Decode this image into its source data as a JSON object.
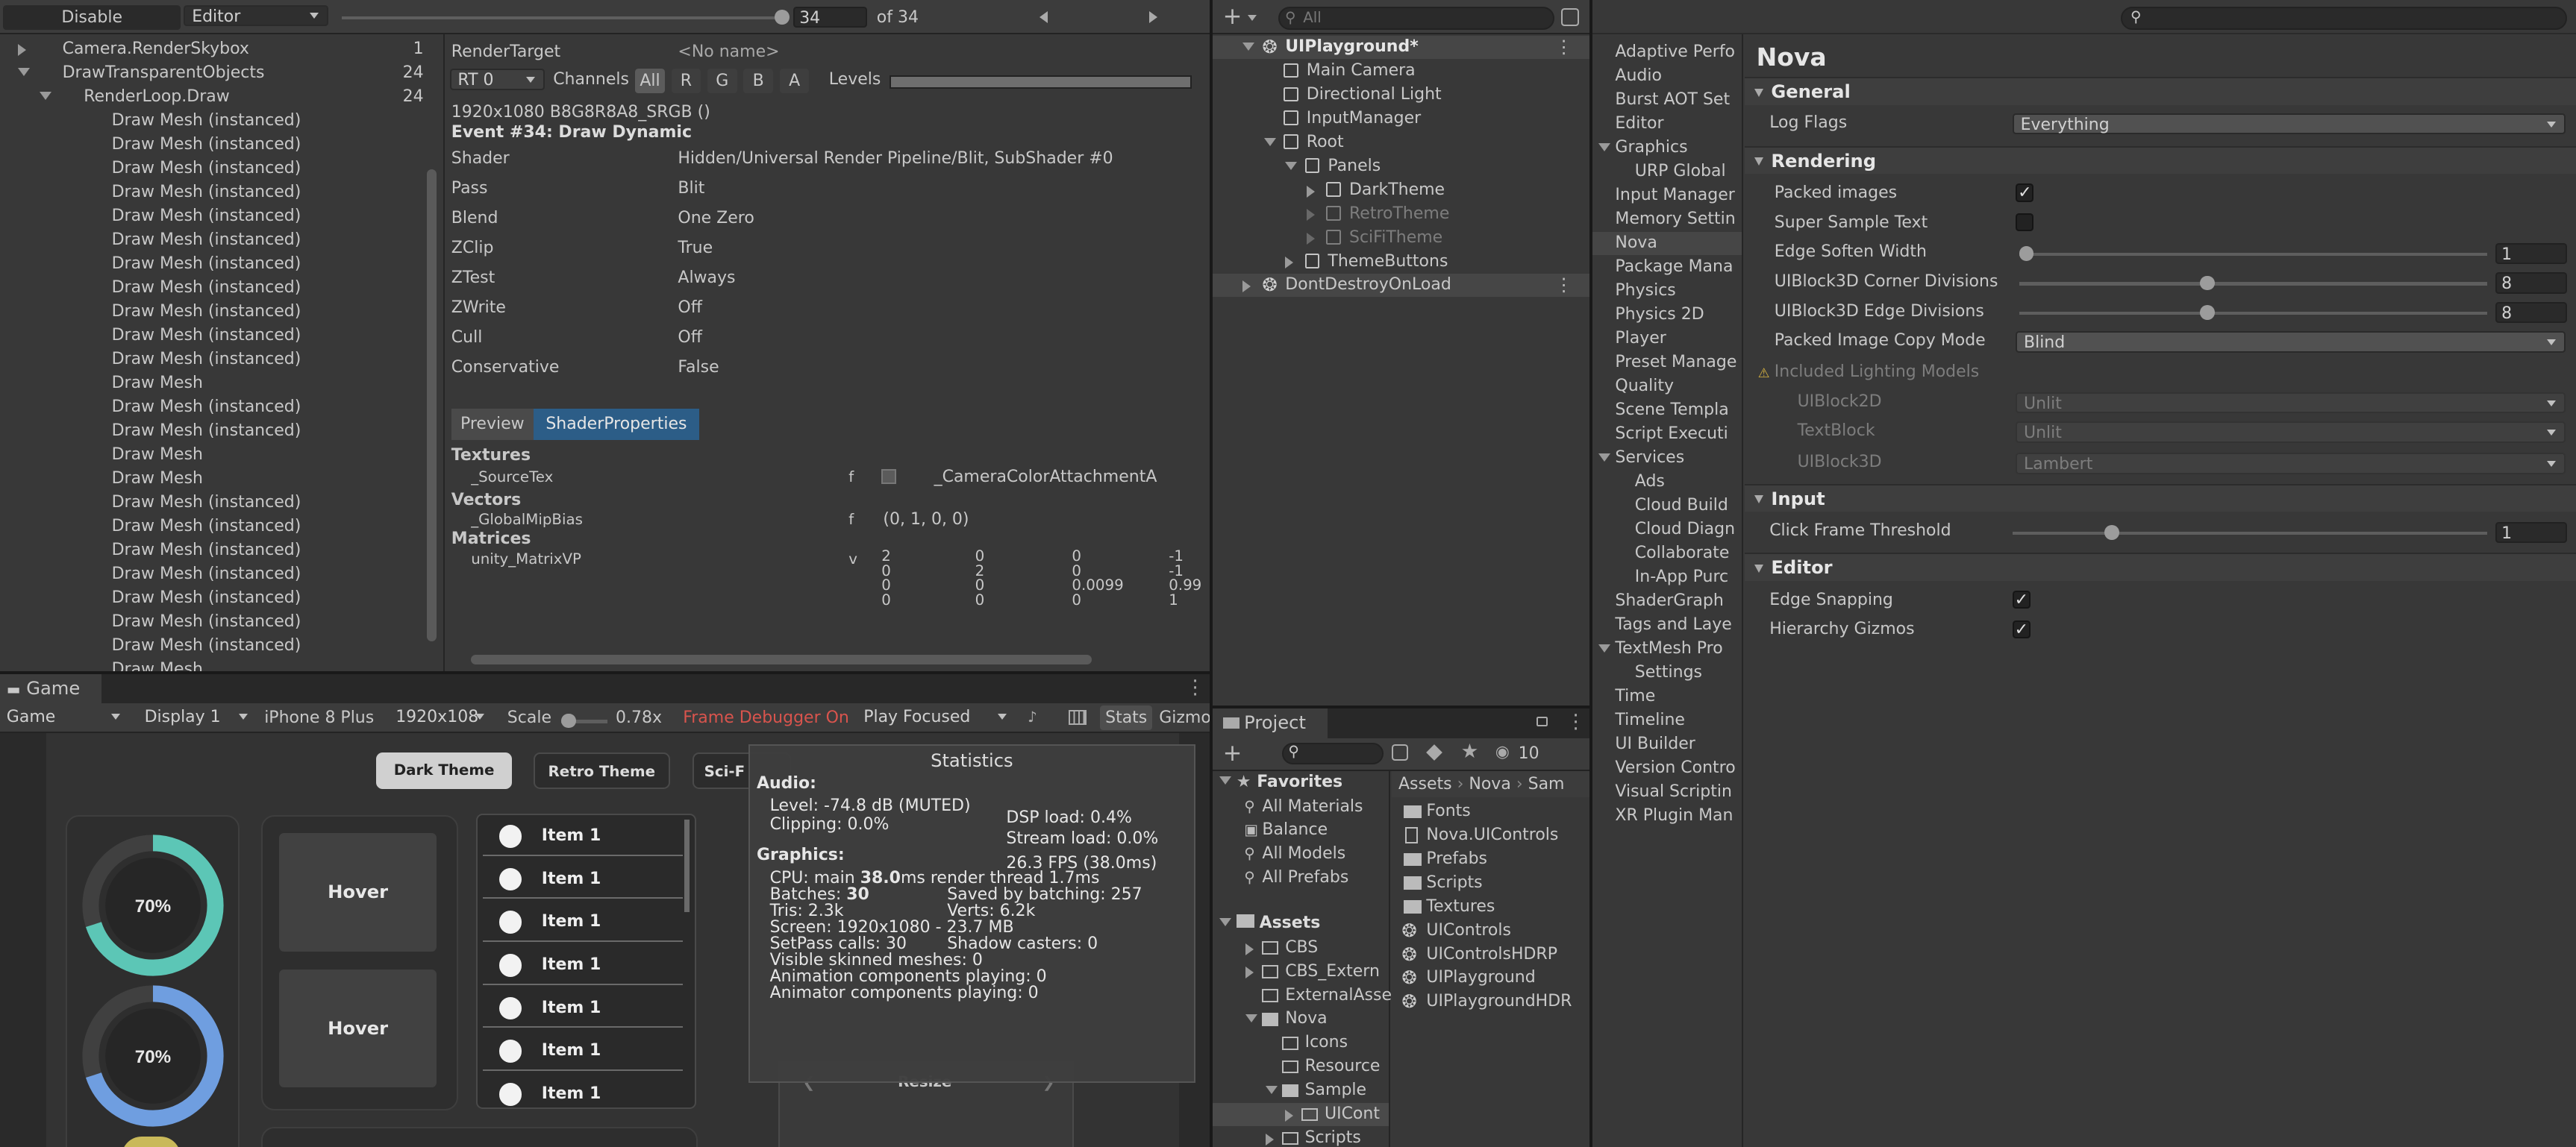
{
  "frame_debugger": {
    "toolbar": {
      "disable": "Disable",
      "editor": "Editor",
      "event_value": "34",
      "of_total": "of 34"
    },
    "tree": [
      {
        "label": "Camera.RenderSkybox",
        "count": "1",
        "indent": 0,
        "arrow": "right"
      },
      {
        "label": "DrawTransparentObjects",
        "count": "24",
        "indent": 0,
        "arrow": "down"
      },
      {
        "label": "RenderLoop.Draw",
        "count": "24",
        "indent": 1,
        "arrow": "down"
      },
      {
        "label": "Draw Mesh (instanced)",
        "count": "",
        "indent": 2
      },
      {
        "label": "Draw Mesh (instanced)",
        "count": "",
        "indent": 2
      },
      {
        "label": "Draw Mesh (instanced)",
        "count": "",
        "indent": 2
      },
      {
        "label": "Draw Mesh (instanced)",
        "count": "",
        "indent": 2
      },
      {
        "label": "Draw Mesh (instanced)",
        "count": "",
        "indent": 2
      },
      {
        "label": "Draw Mesh (instanced)",
        "count": "",
        "indent": 2
      },
      {
        "label": "Draw Mesh (instanced)",
        "count": "",
        "indent": 2
      },
      {
        "label": "Draw Mesh (instanced)",
        "count": "",
        "indent": 2
      },
      {
        "label": "Draw Mesh (instanced)",
        "count": "",
        "indent": 2
      },
      {
        "label": "Draw Mesh (instanced)",
        "count": "",
        "indent": 2
      },
      {
        "label": "Draw Mesh (instanced)",
        "count": "",
        "indent": 2
      },
      {
        "label": "Draw Mesh",
        "count": "",
        "indent": 2
      },
      {
        "label": "Draw Mesh (instanced)",
        "count": "",
        "indent": 2
      },
      {
        "label": "Draw Mesh (instanced)",
        "count": "",
        "indent": 2
      },
      {
        "label": "Draw Mesh",
        "count": "",
        "indent": 2
      },
      {
        "label": "Draw Mesh",
        "count": "",
        "indent": 2
      },
      {
        "label": "Draw Mesh (instanced)",
        "count": "",
        "indent": 2
      },
      {
        "label": "Draw Mesh (instanced)",
        "count": "",
        "indent": 2
      },
      {
        "label": "Draw Mesh (instanced)",
        "count": "",
        "indent": 2
      },
      {
        "label": "Draw Mesh (instanced)",
        "count": "",
        "indent": 2
      },
      {
        "label": "Draw Mesh (instanced)",
        "count": "",
        "indent": 2
      },
      {
        "label": "Draw Mesh (instanced)",
        "count": "",
        "indent": 2
      },
      {
        "label": "Draw Mesh (instanced)",
        "count": "",
        "indent": 2
      },
      {
        "label": "Draw Mesh",
        "count": "",
        "indent": 2
      }
    ],
    "render_target_label": "RenderTarget",
    "render_target_value": "<No name>",
    "rt": "RT 0",
    "channels": "Channels",
    "ch_all": "All",
    "ch_r": "R",
    "ch_g": "G",
    "ch_b": "B",
    "ch_a": "A",
    "levels": "Levels",
    "format": "1920x1080 B8G8R8A8_SRGB ()",
    "event": "Event #34: Draw Dynamic",
    "props": [
      {
        "k": "Shader",
        "v": "Hidden/Universal Render Pipeline/Blit, SubShader #0"
      },
      {
        "k": "Pass",
        "v": "Blit"
      },
      {
        "k": "Blend",
        "v": "One Zero"
      },
      {
        "k": "ZClip",
        "v": "True"
      },
      {
        "k": "ZTest",
        "v": "Always"
      },
      {
        "k": "ZWrite",
        "v": "Off"
      },
      {
        "k": "Cull",
        "v": "Off"
      },
      {
        "k": "Conservative",
        "v": "False"
      }
    ],
    "tab_preview": "Preview",
    "tab_shader": "ShaderProperties",
    "textures": "Textures",
    "tex_name": "_SourceTex",
    "tex_stage": "f",
    "tex_value": "_CameraColorAttachmentA",
    "vectors": "Vectors",
    "vec_name": "_GlobalMipBias",
    "vec_stage": "f",
    "vec_value": "(0, 1, 0, 0)",
    "matrices": "Matrices",
    "mat_name": "unity_MatrixVP",
    "mat_stage": "v",
    "matrix": [
      [
        "2",
        "0",
        "0",
        "-1"
      ],
      [
        "0",
        "2",
        "0",
        "-1"
      ],
      [
        "0",
        "0",
        "0.0099",
        "0.99"
      ],
      [
        "0",
        "0",
        "0",
        "1"
      ]
    ]
  },
  "game": {
    "tab": "Game",
    "mode": "Game",
    "display": "Display 1",
    "device": "iPhone 8 Plus",
    "resolution": "1920x108",
    "scale_label": "Scale",
    "scale_value": "0.78x",
    "frame_debugger_on": "Frame Debugger On",
    "play_focused": "Play Focused",
    "stats": "Stats",
    "gizmos": "Gizmo",
    "dark_theme": "Dark Theme",
    "retro_theme": "Retro Theme",
    "scifi": "Sci-F",
    "gauge1": "70%",
    "gauge2": "70%",
    "gauge_value": 0.7,
    "hover1": "Hover",
    "hover2": "Hover",
    "items": [
      "Item 1",
      "Item 1",
      "Item 1",
      "Item 1",
      "Item 1",
      "Item 1",
      "Item 1"
    ],
    "resize": "Resize"
  },
  "statistics": {
    "title": "Statistics",
    "audio": "Audio:",
    "level": "Level: -74.8 dB (MUTED)",
    "clipping": "Clipping: 0.0%",
    "dsp": "DSP load: 0.4%",
    "stream": "Stream load: 0.0%",
    "fps": "26.3 FPS (38.0ms)",
    "graphics": "Graphics:",
    "cpu_a": "CPU: main ",
    "cpu_b": "38.0",
    "cpu_c": "ms  render thread 1.7ms",
    "batches_a": "Batches: ",
    "batches_b": "30",
    "saved": "Saved by batching: 257",
    "tris": "Tris: 2.3k",
    "verts": "Verts: 6.2k",
    "screen": "Screen: 1920x1080 - 23.7 MB",
    "setpass": "SetPass calls: 30",
    "shadow": "Shadow casters: 0",
    "skinned": "Visible skinned meshes: 0",
    "animation": "Animation components playing: 0",
    "animator": "Animator components playing: 0"
  },
  "hierarchy": {
    "search_placeholder": "All",
    "items": [
      {
        "label": "UIPlayground*",
        "indent": 0,
        "arrow": "down",
        "bold": true,
        "icon": "unity-icon",
        "dim": false
      },
      {
        "label": "Main Camera",
        "indent": 1,
        "arrow": "",
        "icon": "cube-icon",
        "dim": false
      },
      {
        "label": "Directional Light",
        "indent": 1,
        "arrow": "",
        "icon": "cube-icon",
        "dim": false
      },
      {
        "label": "InputManager",
        "indent": 1,
        "arrow": "",
        "icon": "cube-icon",
        "dim": false
      },
      {
        "label": "Root",
        "indent": 1,
        "arrow": "down",
        "icon": "cube-icon",
        "dim": false
      },
      {
        "label": "Panels",
        "indent": 2,
        "arrow": "down",
        "icon": "cube-icon",
        "dim": false
      },
      {
        "label": "DarkTheme",
        "indent": 3,
        "arrow": "right",
        "icon": "cube-icon",
        "dim": false
      },
      {
        "label": "RetroTheme",
        "indent": 3,
        "arrow": "right",
        "icon": "cube-icon",
        "dim": true
      },
      {
        "label": "SciFiTheme",
        "indent": 3,
        "arrow": "right",
        "icon": "cube-icon",
        "dim": true
      },
      {
        "label": "ThemeButtons",
        "indent": 2,
        "arrow": "right",
        "icon": "cube-icon",
        "dim": false
      },
      {
        "label": "DontDestroyOnLoad",
        "indent": 0,
        "arrow": "right",
        "icon": "unity-icon",
        "dim": false
      }
    ]
  },
  "project": {
    "tab": "Project",
    "hidden_count": "10",
    "favorites": "Favorites",
    "fav_items": [
      "All Materials",
      "Balance",
      "All Models",
      "All Prefabs"
    ],
    "assets": "Assets",
    "asset_tree": [
      {
        "label": "CBS",
        "indent": 1,
        "arrow": "right"
      },
      {
        "label": "CBS_Extern",
        "indent": 1,
        "arrow": "right"
      },
      {
        "label": "ExternalAsse",
        "indent": 1,
        "arrow": ""
      },
      {
        "label": "Nova",
        "indent": 1,
        "arrow": "down"
      },
      {
        "label": "Icons",
        "indent": 2,
        "arrow": ""
      },
      {
        "label": "Resource",
        "indent": 2,
        "arrow": ""
      },
      {
        "label": "Sample",
        "indent": 2,
        "arrow": "down"
      },
      {
        "label": "UICont",
        "indent": 3,
        "arrow": "right"
      },
      {
        "label": "Scripts",
        "indent": 2,
        "arrow": "right"
      }
    ],
    "breadcrumb": [
      "Assets",
      "Nova",
      "Sam"
    ],
    "files": [
      {
        "label": "Fonts",
        "icon": "folder-icon"
      },
      {
        "label": "Nova.UIControls",
        "icon": "file-icon"
      },
      {
        "label": "Prefabs",
        "icon": "folder-icon"
      },
      {
        "label": "Scripts",
        "icon": "folder-icon"
      },
      {
        "label": "Textures",
        "icon": "folder-icon"
      },
      {
        "label": "UIControls",
        "icon": "unity-icon"
      },
      {
        "label": "UIControlsHDRP",
        "icon": "unity-icon"
      },
      {
        "label": "UIPlayground",
        "icon": "unity-icon"
      },
      {
        "label": "UIPlaygroundHDR",
        "icon": "unity-icon"
      }
    ]
  },
  "settings": {
    "categories": [
      {
        "label": "Adaptive Perfo",
        "indent": 0,
        "arrow": ""
      },
      {
        "label": "Audio",
        "indent": 0,
        "arrow": ""
      },
      {
        "label": "Burst AOT Set",
        "indent": 0,
        "arrow": ""
      },
      {
        "label": "Editor",
        "indent": 0,
        "arrow": ""
      },
      {
        "label": "Graphics",
        "indent": 0,
        "arrow": "down"
      },
      {
        "label": "URP Global",
        "indent": 1,
        "arrow": ""
      },
      {
        "label": "Input Manager",
        "indent": 0,
        "arrow": ""
      },
      {
        "label": "Memory Settin",
        "indent": 0,
        "arrow": ""
      },
      {
        "label": "Nova",
        "indent": 0,
        "arrow": "",
        "selected": true
      },
      {
        "label": "Package Mana",
        "indent": 0,
        "arrow": ""
      },
      {
        "label": "Physics",
        "indent": 0,
        "arrow": ""
      },
      {
        "label": "Physics 2D",
        "indent": 0,
        "arrow": ""
      },
      {
        "label": "Player",
        "indent": 0,
        "arrow": ""
      },
      {
        "label": "Preset Manage",
        "indent": 0,
        "arrow": ""
      },
      {
        "label": "Quality",
        "indent": 0,
        "arrow": ""
      },
      {
        "label": "Scene Templa",
        "indent": 0,
        "arrow": ""
      },
      {
        "label": "Script Executi",
        "indent": 0,
        "arrow": ""
      },
      {
        "label": "Services",
        "indent": 0,
        "arrow": "down"
      },
      {
        "label": "Ads",
        "indent": 1,
        "arrow": ""
      },
      {
        "label": "Cloud Build",
        "indent": 1,
        "arrow": ""
      },
      {
        "label": "Cloud Diagn",
        "indent": 1,
        "arrow": ""
      },
      {
        "label": "Collaborate",
        "indent": 1,
        "arrow": ""
      },
      {
        "label": "In-App Purc",
        "indent": 1,
        "arrow": ""
      },
      {
        "label": "ShaderGraph",
        "indent": 0,
        "arrow": ""
      },
      {
        "label": "Tags and Laye",
        "indent": 0,
        "arrow": ""
      },
      {
        "label": "TextMesh Pro",
        "indent": 0,
        "arrow": "down"
      },
      {
        "label": "Settings",
        "indent": 1,
        "arrow": ""
      },
      {
        "label": "Time",
        "indent": 0,
        "arrow": ""
      },
      {
        "label": "Timeline",
        "indent": 0,
        "arrow": ""
      },
      {
        "label": "UI Builder",
        "indent": 0,
        "arrow": ""
      },
      {
        "label": "Version Contro",
        "indent": 0,
        "arrow": ""
      },
      {
        "label": "Visual Scriptin",
        "indent": 0,
        "arrow": ""
      },
      {
        "label": "XR Plugin Man",
        "indent": 0,
        "arrow": ""
      }
    ]
  },
  "nova": {
    "title": "Nova",
    "general": "General",
    "log_flags_label": "Log Flags",
    "log_flags_value": "Everything",
    "rendering": "Rendering",
    "packed_images": "Packed images",
    "packed_images_checked": "✓",
    "super_sample": "Super Sample Text",
    "super_sample_checked": "",
    "edge_soften": "Edge Soften Width",
    "edge_soften_value": "1",
    "edge_soften_level": 0.0,
    "corner_div": "UIBlock3D Corner Divisions",
    "corner_div_value": "8",
    "corner_div_level": 0.4,
    "edge_div": "UIBlock3D Edge Divisions",
    "edge_div_value": "8",
    "edge_div_level": 0.4,
    "copy_mode": "Packed Image Copy Mode",
    "copy_mode_value": "Blind",
    "lighting": "Included Lighting Models",
    "uib2d": "UIBlock2D",
    "uib2d_value": "Unlit",
    "textblock": "TextBlock",
    "textblock_value": "Unlit",
    "uib3d": "UIBlock3D",
    "uib3d_value": "Lambert",
    "input": "Input",
    "click_threshold": "Click Frame Threshold",
    "click_threshold_value": "1",
    "click_level": 0.2,
    "editor": "Editor",
    "edge_snapping": "Edge Snapping",
    "edge_snapping_checked": "✓",
    "hier_gizmos": "Hierarchy Gizmos",
    "hier_gizmos_checked": "✓"
  },
  "colors": {
    "accent": "#2c5d87",
    "gauge_teal": "#5cc6b6",
    "gauge_blue": "#6f9ee0",
    "red_text": "#d9544d",
    "selected_row": "#2c5d87"
  }
}
